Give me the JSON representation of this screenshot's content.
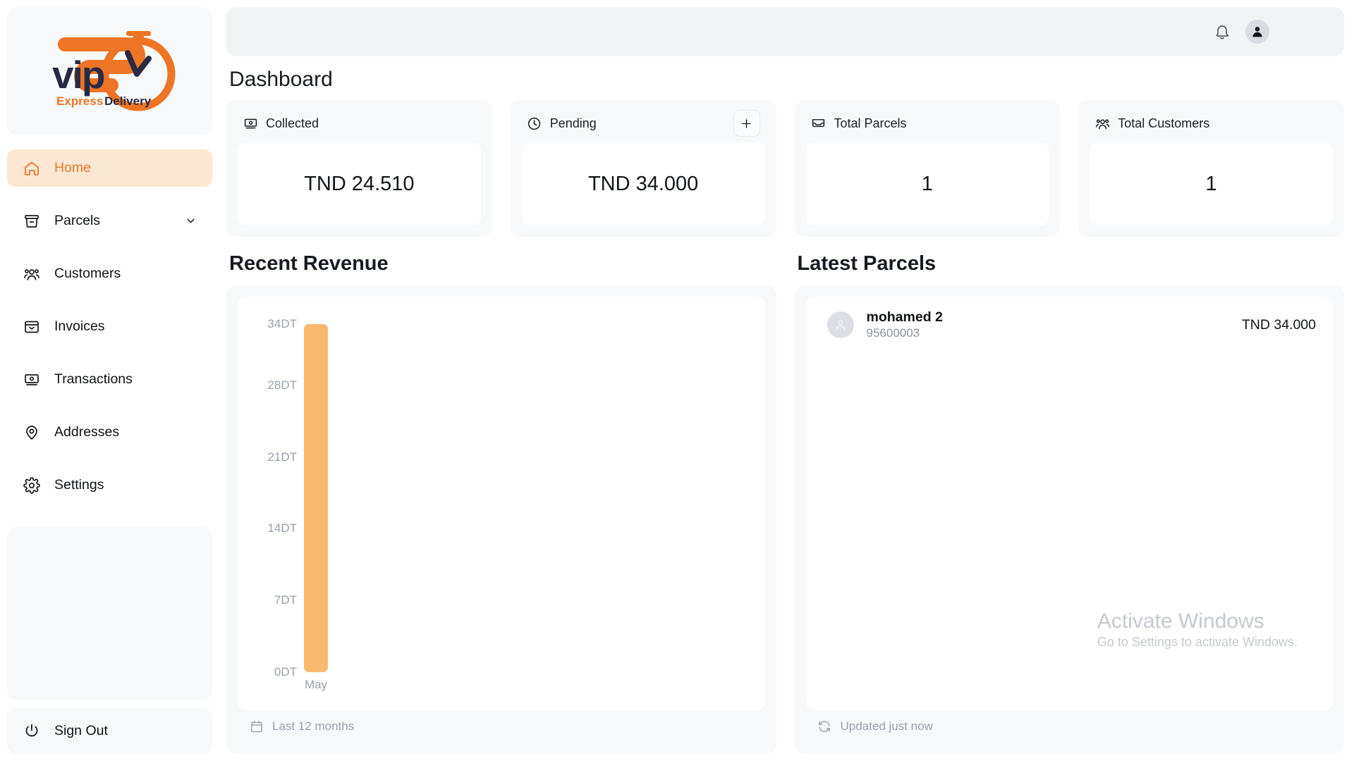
{
  "brand": {
    "name": "VIP",
    "tagline_1": "Express",
    "tagline_2": "Delivery",
    "accent_color": "#ee7525",
    "dark_color": "#2b2a45"
  },
  "sidebar": {
    "items": [
      {
        "label": "Home",
        "icon": "home-icon",
        "active": true,
        "chevron": false
      },
      {
        "label": "Parcels",
        "icon": "box-icon",
        "active": false,
        "chevron": true
      },
      {
        "label": "Customers",
        "icon": "users-icon",
        "active": false,
        "chevron": false
      },
      {
        "label": "Invoices",
        "icon": "invoice-icon",
        "active": false,
        "chevron": false
      },
      {
        "label": "Transactions",
        "icon": "banknote-icon",
        "active": false,
        "chevron": false
      },
      {
        "label": "Addresses",
        "icon": "map-pin-icon",
        "active": false,
        "chevron": false
      },
      {
        "label": "Settings",
        "icon": "gear-icon",
        "active": false,
        "chevron": false
      }
    ],
    "sign_out": {
      "label": "Sign Out",
      "icon": "power-icon"
    }
  },
  "topbar": {
    "notifications_icon": "bell-icon",
    "avatar_icon": "user-avatar-icon"
  },
  "header": {
    "title": "Dashboard"
  },
  "stats": [
    {
      "label": "Collected",
      "icon": "banknote-icon",
      "value": "TND 24.510",
      "action": null
    },
    {
      "label": "Pending",
      "icon": "clock-icon",
      "value": "TND 34.000",
      "action": "+"
    },
    {
      "label": "Total Parcels",
      "icon": "inbox-icon",
      "value": "1",
      "action": null
    },
    {
      "label": "Total Customers",
      "icon": "users-icon",
      "value": "1",
      "action": null
    }
  ],
  "revenue_panel": {
    "title": "Recent Revenue",
    "footer_label": "Last 12 months",
    "footer_icon": "calendar-icon"
  },
  "parcels_panel": {
    "title": "Latest Parcels",
    "footer_label": "Updated just now",
    "footer_icon": "refresh-icon",
    "rows": [
      {
        "name": "mohamed 2",
        "phone": "95600003",
        "amount": "TND 34.000",
        "avatar_icon": "user-avatar-icon"
      }
    ]
  },
  "watermark": {
    "title": "Activate Windows",
    "subtitle": "Go to Settings to activate Windows."
  },
  "chart_data": {
    "type": "bar",
    "title": "Recent Revenue",
    "categories": [
      "May"
    ],
    "values": [
      34
    ],
    "xlabel": "",
    "ylabel": "",
    "ylim": [
      0,
      35
    ],
    "ytick_labels": [
      "34DT",
      "28DT",
      "21DT",
      "14DT",
      "7DT",
      "0DT"
    ],
    "ytick_values": [
      34,
      28,
      21,
      14,
      7,
      0
    ],
    "unit": "DT",
    "bar_color": "#fbb96f",
    "grid": false,
    "legend": "none"
  }
}
